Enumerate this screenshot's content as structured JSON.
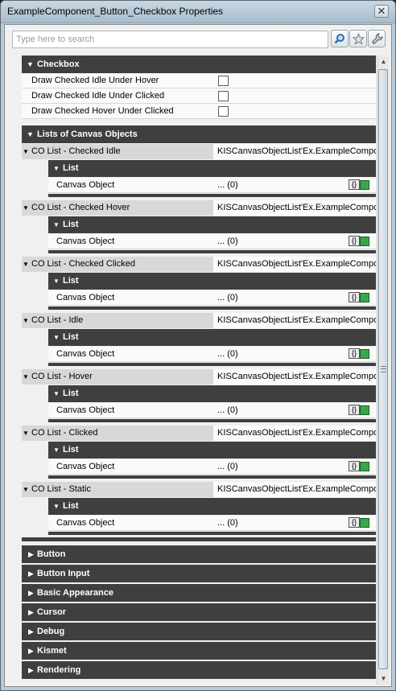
{
  "window": {
    "title": "ExampleComponent_Button_Checkbox Properties",
    "close_label": "✕"
  },
  "search": {
    "placeholder": "Type here to search",
    "value": ""
  },
  "toolbar": {
    "search_icon": "magnifier-icon",
    "favorite_icon": "star-icon",
    "settings_icon": "wrench-icon"
  },
  "checkbox_section": {
    "label": "Checkbox",
    "properties": [
      {
        "name": "Draw Checked Idle Under Hover",
        "checked": false
      },
      {
        "name": "Draw Checked Idle Under Clicked",
        "checked": false
      },
      {
        "name": "Draw Checked Hover Under Clicked",
        "checked": false
      }
    ]
  },
  "lists_section": {
    "label": "Lists of Canvas Objects",
    "list_label": "List",
    "item_name": "Canvas Object",
    "item_value": "... (0)",
    "items": [
      {
        "name": "CO List - Checked Idle",
        "value": "KISCanvasObjectList'Ex.ExampleCompon"
      },
      {
        "name": "CO List - Checked Hover",
        "value": "KISCanvasObjectList'Ex.ExampleCompon"
      },
      {
        "name": "CO List - Checked Clicked",
        "value": "KISCanvasObjectList'Ex.ExampleCompon"
      },
      {
        "name": "CO List - Idle",
        "value": "KISCanvasObjectList'Ex.ExampleCompon"
      },
      {
        "name": "CO List - Hover",
        "value": "KISCanvasObjectList'Ex.ExampleCompon"
      },
      {
        "name": "CO List - Clicked",
        "value": "KISCanvasObjectList'Ex.ExampleCompon"
      },
      {
        "name": "CO List - Static",
        "value": "KISCanvasObjectList'Ex.ExampleCompon"
      }
    ]
  },
  "collapsed_sections": [
    "Button",
    "Button Input",
    "Basic Appearance",
    "Cursor",
    "Debug",
    "Kismet",
    "Rendering"
  ]
}
